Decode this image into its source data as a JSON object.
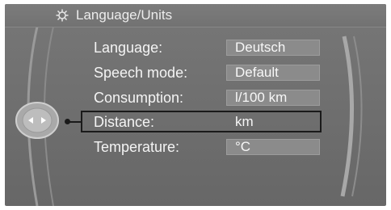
{
  "header": {
    "title": "Language/Units",
    "icon": "settings-gear-icon"
  },
  "settings": [
    {
      "label": "Language:",
      "value": "Deutsch"
    },
    {
      "label": "Speech mode:",
      "value": "Default"
    },
    {
      "label": "Consumption:",
      "value": "l/100 km"
    },
    {
      "label": "Distance:",
      "value": "km"
    },
    {
      "label": "Temperature:",
      "value": "°C"
    }
  ],
  "selected_item": "Distance:",
  "controller": {
    "icon": "controller-left-right-icon"
  }
}
